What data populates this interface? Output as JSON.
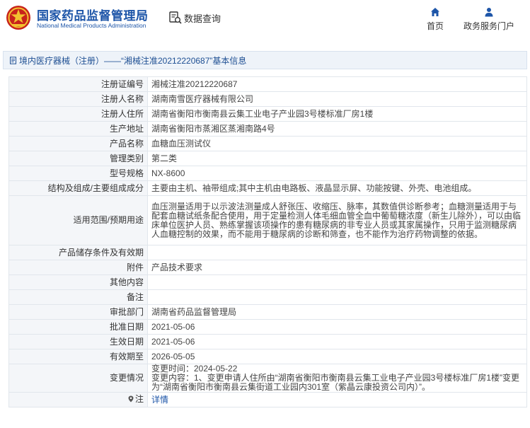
{
  "header": {
    "org_cn": "国家药品监督管理局",
    "org_en": "National Medical Products Administration",
    "data_query": "数据查询",
    "nav": [
      {
        "label": "首页",
        "icon": "home-icon"
      },
      {
        "label": "政务服务门户",
        "icon": "user-icon"
      }
    ]
  },
  "title": "境内医疗器械（注册）——“湘械注准20212220687”基本信息",
  "rows": [
    {
      "label": "注册证编号",
      "value": "湘械注准20212220687"
    },
    {
      "label": "注册人名称",
      "value": "湖南南雪医疗器械有限公司"
    },
    {
      "label": "注册人住所",
      "value": "湖南省衡阳市衡南县云集工业电子产业园3号楼标准厂房1楼"
    },
    {
      "label": "生产地址",
      "value": "湖南省衡阳市蒸湘区蒸湘南路4号"
    },
    {
      "label": "产品名称",
      "value": "血糖血压测试仪"
    },
    {
      "label": "管理类别",
      "value": "第二类"
    },
    {
      "label": "型号规格",
      "value": "NX-8600"
    },
    {
      "label": "结构及组成/主要组成成分",
      "value": "主要由主机、袖带组成;其中主机由电路板、液晶显示屏、功能按键、外壳、电池组成。"
    },
    {
      "label": "适用范围/预期用途",
      "value": "血压测量适用于以示波法测量成人舒张压、收缩压、脉率，其数值供诊断参考；血糖测量适用于与配套血糖试纸条配合使用，用于定量检测人体毛细血管全血中葡萄糖浓度（新生儿除外），可以由临床单位医护人员、熟练掌握该项操作的患有糖尿病的非专业人员或其家属操作，只用于监测糖尿病人血糖控制的效果，而不能用于糖尿病的诊断和筛查，也不能作为治疗药物调整的依据。"
    },
    {
      "label": "产品储存条件及有效期",
      "value": ""
    },
    {
      "label": "附件",
      "value": "产品技术要求"
    },
    {
      "label": "其他内容",
      "value": ""
    },
    {
      "label": "备注",
      "value": ""
    },
    {
      "label": "审批部门",
      "value": "湖南省药品监督管理局"
    },
    {
      "label": "批准日期",
      "value": "2021-05-06"
    },
    {
      "label": "生效日期",
      "value": "2021-05-06"
    },
    {
      "label": "有效期至",
      "value": "2026-05-05"
    },
    {
      "label": "变更情况",
      "value": "变更时间：2024-05-22\n变更内容：1、变更申请人住所由“湖南省衡阳市衡南县云集工业电子产业园3号楼标准厂房1楼”变更为“湖南省衡阳市衡南县云集街道工业园内301室（紫晶云康投资公司内）”。"
    },
    {
      "label": "注",
      "value": "详情"
    }
  ]
}
